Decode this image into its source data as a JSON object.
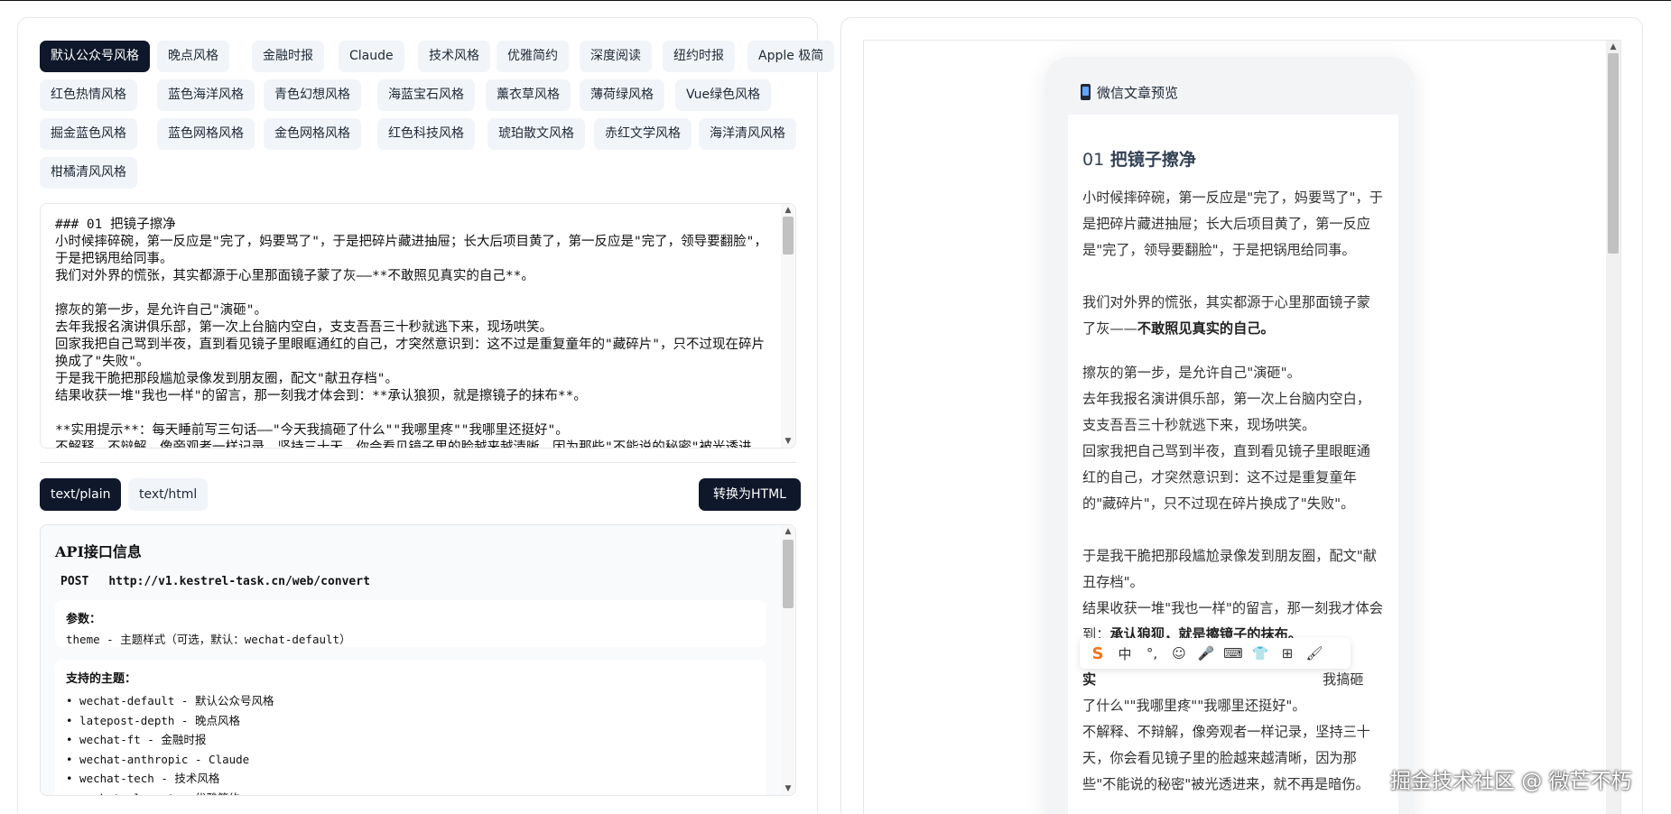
{
  "themes": [
    {
      "label": "默认公众号风格",
      "active": true
    },
    {
      "label": "晚点风格"
    },
    {
      "label": "金融时报"
    },
    {
      "label": "Claude"
    },
    {
      "label": "技术风格"
    },
    {
      "label": "优雅简约"
    },
    {
      "label": "深度阅读"
    },
    {
      "label": "纽约时报"
    },
    {
      "label": "Apple 极简"
    },
    {
      "label": "红色热情风格"
    },
    {
      "label": "蓝色海洋风格"
    },
    {
      "label": "青色幻想风格"
    },
    {
      "label": "海蓝宝石风格"
    },
    {
      "label": "薰衣草风格"
    },
    {
      "label": "薄荷绿风格"
    },
    {
      "label": "Vue绿色风格"
    },
    {
      "label": "掘金蓝色风格"
    },
    {
      "label": "蓝色网格风格"
    },
    {
      "label": "金色网格风格"
    },
    {
      "label": "红色科技风格"
    },
    {
      "label": "琥珀散文风格"
    },
    {
      "label": "赤红文学风格"
    },
    {
      "label": "海洋清风风格"
    },
    {
      "label": "柑橘清风风格"
    }
  ],
  "editor": {
    "content": "### 01 把镜子擦净\n小时候摔碎碗，第一反应是\"完了，妈要骂了\"，于是把碎片藏进抽屉；长大后项目黄了，第一反应是\"完了，领导要翻脸\"，于是把锅甩给同事。\n我们对外界的慌张，其实都源于心里那面镜子蒙了灰——**不敢照见真实的自己**。\n\n擦灰的第一步，是允许自己\"演砸\"。\n去年我报名演讲俱乐部，第一次上台脑内空白，支支吾吾三十秒就逃下来，现场哄笑。\n回家我把自己骂到半夜，直到看见镜子里眼眶通红的自己，才突然意识到：这不过是重复童年的\"藏碎片\"，只不过现在碎片换成了\"失败\"。\n于是我干脆把那段尴尬录像发到朋友圈，配文\"献丑存档\"。\n结果收获一堆\"我也一样\"的留言，那一刻我才体会到：**承认狼狈，就是擦镜子的抹布**。\n\n**实用提示**：每天睡前写三句话——\"今天我搞砸了什么\"\"我哪里疼\"\"我哪里还挺好\"。\n不解释、不辩解，像旁观者一样记录，坚持三十天，你会看见镜子里的脸越来越清晰，因为那些\"不能说的秘密\"被光透进来，就不再是暗伤。"
  },
  "format_tabs": {
    "plain": "text/plain",
    "html": "text/html"
  },
  "convert_label": "转换为HTML",
  "api": {
    "title": "API接口信息",
    "method": "POST",
    "url": "http://v1.kestrel-task.cn/web/convert",
    "params_title": "参数：",
    "params_line": "theme - 主题样式（可选，默认：wechat-default）",
    "themes_title": "支持的主题：",
    "theme_lines": [
      "• wechat-default - 默认公众号风格",
      "• latepost-depth - 晚点风格",
      "• wechat-ft - 金融时报",
      "• wechat-anthropic - Claude",
      "• wechat-tech - 技术风格",
      "• wechat-elegant - 优雅简约"
    ]
  },
  "preview": {
    "header_title": "微信文章预览",
    "heading_num": "01",
    "heading_text": "把镜子擦净",
    "p1": "小时候摔碎碗，第一反应是\"完了，妈要骂了\"，于是把碎片藏进抽屉；长大后项目黄了，第一反应是\"完了，领导要翻脸\"，于是把锅甩给同事。",
    "p2_text": "我们对外界的慌张，其实都源于心里那面镜子蒙了灰——",
    "p2_bold": "不敢照见真实的自己。",
    "p3": "擦灰的第一步，是允许自己\"演砸\"。",
    "p4": "去年我报名演讲俱乐部，第一次上台脑内空白，支支吾吾三十秒就逃下来，现场哄笑。",
    "p5": "回家我把自己骂到半夜，直到看见镜子里眼眶通红的自己，才突然意识到：这不过是重复童年的\"藏碎片\"，只不过现在碎片换成了\"失败\"。",
    "p6": "于是我干脆把那段尴尬录像发到朋友圈，配文\"献丑存档\"。",
    "p7_text": "结果收获一堆\"我也一样\"的留言，那一刻我才体会到：",
    "p7_bold": "承认狼狈，就是擦镜子的抹布。",
    "p8_bold": "实",
    "p8_tail": "我搞砸",
    "p8_line2": "了什么\"\"我哪里疼\"\"我哪里还挺好\"。",
    "p9": "不解释、不辩解，像旁观者一样记录，坚持三十天，你会看见镜子里的脸越来越清晰，因为那些\"不能说的秘密\"被光透进来，就不再是暗伤。"
  },
  "ime": {
    "items": [
      "中",
      "°,",
      "☺",
      "🎤",
      "⌨",
      "👕",
      "⊞",
      "🖌"
    ]
  },
  "watermark": "掘金技术社区 @ 微芒不朽"
}
